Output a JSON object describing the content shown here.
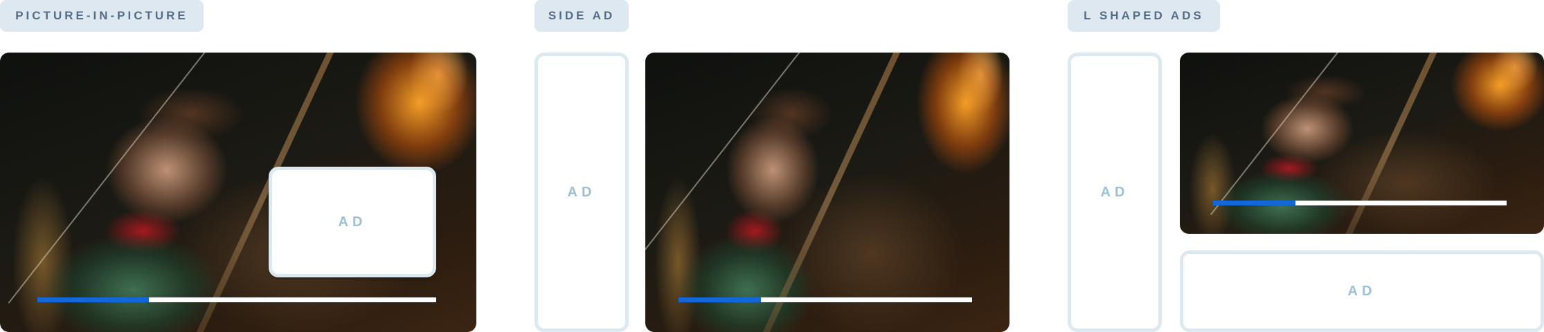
{
  "panels": [
    {
      "label": "PICTURE-IN-PICTURE",
      "ad_label": "AD",
      "progress": 0.28
    },
    {
      "label": "SIDE AD",
      "ad_label": "AD",
      "progress": 0.28
    },
    {
      "label": "L SHAPED ADS",
      "ad_label_side": "AD",
      "ad_label_bottom": "AD",
      "progress": 0.28
    }
  ],
  "colors": {
    "tag_bg": "#dde8f0",
    "tag_text": "#546c86",
    "ad_border": "#dde9f1",
    "ad_text": "#9cc0d6",
    "progress_fill": "#1467d8"
  }
}
